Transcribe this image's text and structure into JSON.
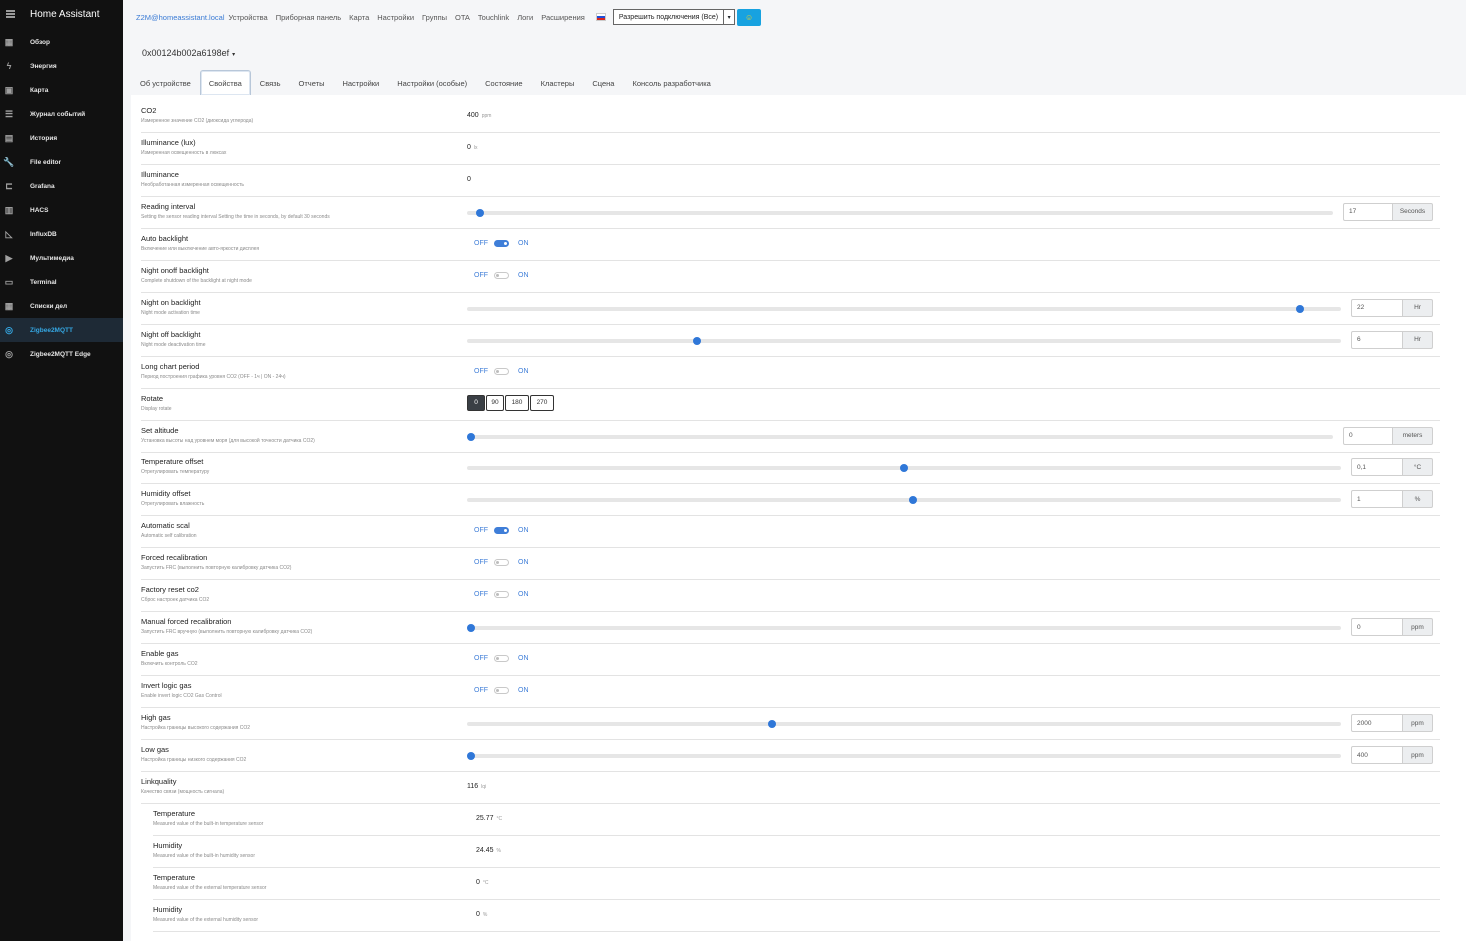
{
  "app": {
    "title": "Home Assistant"
  },
  "sidebar": {
    "items": [
      {
        "label": "Обзор",
        "icon": "dashboard-icon",
        "glyph": "▦"
      },
      {
        "label": "Энергия",
        "icon": "lightning-icon",
        "glyph": "ϟ"
      },
      {
        "label": "Карта",
        "icon": "map-icon",
        "glyph": "▣"
      },
      {
        "label": "Журнал событий",
        "icon": "logbook-icon",
        "glyph": "☰"
      },
      {
        "label": "История",
        "icon": "history-icon",
        "glyph": "▤"
      },
      {
        "label": "File editor",
        "icon": "wrench-icon",
        "glyph": "🔧"
      },
      {
        "label": "Grafana",
        "icon": "chart-icon",
        "glyph": "⊏"
      },
      {
        "label": "HACS",
        "icon": "hacs-icon",
        "glyph": "▥"
      },
      {
        "label": "InfluxDB",
        "icon": "area-chart-icon",
        "glyph": "◺"
      },
      {
        "label": "Мультимедиа",
        "icon": "media-icon",
        "glyph": "▶"
      },
      {
        "label": "Terminal",
        "icon": "terminal-icon",
        "glyph": "▭"
      },
      {
        "label": "Списки дел",
        "icon": "todo-icon",
        "glyph": "▦"
      },
      {
        "label": "Zigbee2MQTT",
        "icon": "zigbee-icon",
        "glyph": "◎",
        "active": true
      },
      {
        "label": "Zigbee2MQTT Edge",
        "icon": "zigbee-edge-icon",
        "glyph": "◎"
      }
    ]
  },
  "topnav": {
    "brand": "Z2M@homeassistant.local",
    "links": [
      "Устройства",
      "Приборная панель",
      "Карта",
      "Настройки",
      "Группы",
      "OTA",
      "Touchlink",
      "Логи",
      "Расширения"
    ],
    "permit_join": "Разрешить подключения (Все)",
    "permit_icon": "☺"
  },
  "device": {
    "id": "0x00124b002a6198ef"
  },
  "tabs": [
    "Об устройстве",
    "Свойства",
    "Связь",
    "Отчеты",
    "Настройки",
    "Настройки (особые)",
    "Состояние",
    "Кластеры",
    "Сцена",
    "Консоль разработчика"
  ],
  "active_tab": 1,
  "rows": [
    {
      "kind": "value",
      "label": "CO2",
      "desc": "Измеренное значение CO2 (диоксида углерода)",
      "value": "400",
      "unit": "ppm"
    },
    {
      "kind": "value",
      "label": "Illuminance (lux)",
      "desc": "Измеренная освещенность в люксах",
      "value": "0",
      "unit": "lx"
    },
    {
      "kind": "value",
      "label": "Illuminance",
      "desc": "Необработанная измеренная освещенность",
      "value": "0",
      "unit": ""
    },
    {
      "kind": "slider",
      "label": "Reading interval",
      "desc": "Setting the sensor reading interval Setting the time in seconds, by default 30 seconds",
      "value": "17",
      "unit": "Seconds",
      "fraction": 0.01
    },
    {
      "kind": "toggle",
      "label": "Auto backlight",
      "desc": "Включение или выключение авто-яркости дисплея",
      "on": true
    },
    {
      "kind": "toggle",
      "label": "Night onoff backlight",
      "desc": "Complete shutdown of the backlight at night mode",
      "on": false
    },
    {
      "kind": "slider",
      "label": "Night on backlight",
      "desc": "Night mode activation time",
      "value": "22",
      "unit": "Hr",
      "fraction": 0.957
    },
    {
      "kind": "slider",
      "label": "Night off backlight",
      "desc": "Night mode deactivation time",
      "value": "6",
      "unit": "Hr",
      "fraction": 0.261
    },
    {
      "kind": "toggle",
      "label": "Long chart period",
      "desc": "Период построения графика уровня CO2 (OFF - 1ч | ON - 24ч)",
      "on": false
    },
    {
      "kind": "buttons",
      "label": "Rotate",
      "desc": "Display rotate",
      "options": [
        "0",
        "90",
        "180",
        "270"
      ],
      "selected": 0
    },
    {
      "kind": "slider",
      "label": "Set altitude",
      "desc": "Установка высоты над уровнем моря (для высокой точности датчика CO2)",
      "value": "0",
      "unit": "meters",
      "fraction": 0.0
    },
    {
      "kind": "slider",
      "label": "Temperature offset",
      "desc": "Отрегулировать температуру",
      "value": "0,1",
      "unit": "°C",
      "fraction": 0.5
    },
    {
      "kind": "slider",
      "label": "Humidity offset",
      "desc": "Отрегулировать влажность",
      "value": "1",
      "unit": "%",
      "fraction": 0.51
    },
    {
      "kind": "toggle",
      "label": "Automatic scal",
      "desc": "Automatic self calibration",
      "on": true
    },
    {
      "kind": "toggle",
      "label": "Forced recalibration",
      "desc": "Запустить FRC (выполнить повторную калибровку датчика CO2)",
      "on": false
    },
    {
      "kind": "toggle",
      "label": "Factory reset co2",
      "desc": "Сброс настроек датчика CO2",
      "on": false
    },
    {
      "kind": "slider",
      "label": "Manual forced recalibration",
      "desc": "Запустить FRC вручную (выполнить повторную калибровку датчика CO2)",
      "value": "0",
      "unit": "ppm",
      "fraction": 0.0
    },
    {
      "kind": "toggle",
      "label": "Enable gas",
      "desc": "Включить контроль CO2",
      "on": false
    },
    {
      "kind": "toggle",
      "label": "Invert logic gas",
      "desc": "Enable invert logic CO2 Gas Control",
      "on": false
    },
    {
      "kind": "slider",
      "label": "High gas",
      "desc": "Настройка границы высокого содержания CO2",
      "value": "2000",
      "unit": "ppm",
      "fraction": 0.348
    },
    {
      "kind": "slider",
      "label": "Low gas",
      "desc": "Настройка границы низкого содержания CO2",
      "value": "400",
      "unit": "ppm",
      "fraction": 0.0
    },
    {
      "kind": "value",
      "label": "Linkquality",
      "desc": "Качество связи (мощность сигнала)",
      "value": "116",
      "unit": "lqi"
    },
    {
      "kind": "value",
      "sub": true,
      "label": "Temperature",
      "desc": "Measured value of the built-in temperature sensor",
      "value": "25.77",
      "unit": "°C"
    },
    {
      "kind": "value",
      "sub": true,
      "label": "Humidity",
      "desc": "Measured value of the built-in humidity sensor",
      "value": "24.45",
      "unit": "%"
    },
    {
      "kind": "value",
      "sub": true,
      "label": "Temperature",
      "desc": "Measured value of the external temperature sensor",
      "value": "0",
      "unit": "°C"
    },
    {
      "kind": "value",
      "sub": true,
      "label": "Humidity",
      "desc": "Measured value of the external humidity sensor",
      "value": "0",
      "unit": "%"
    }
  ],
  "toggle_labels": {
    "off": "OFF",
    "on": "ON"
  },
  "colors": {
    "accent": "#2f77d8",
    "sidebar_bg": "#111111",
    "sidebar_active": "#35a8e4"
  }
}
